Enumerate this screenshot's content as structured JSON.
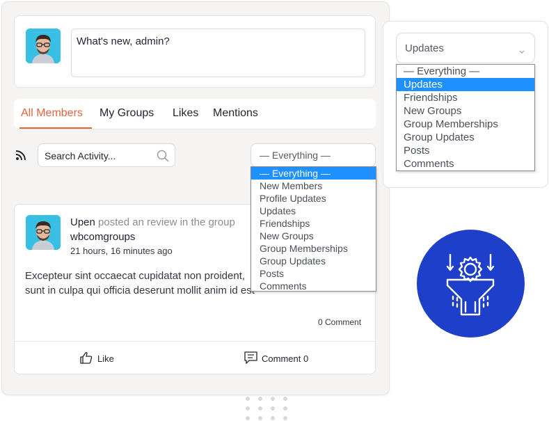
{
  "composer": {
    "placeholder": "What's new, admin?"
  },
  "tabs": [
    {
      "label": "All Members"
    },
    {
      "label": "My Groups"
    },
    {
      "label": "Likes"
    },
    {
      "label": "Mentions"
    }
  ],
  "search": {
    "placeholder": "Search Activity..."
  },
  "filter_main": {
    "selected": "— Everything —",
    "options": [
      "— Everything —",
      "New Members",
      "Profile Updates",
      "Updates",
      "Friendships",
      "New Groups",
      "Group Memberships",
      "Group Updates",
      "Posts",
      "Comments"
    ]
  },
  "filter_side": {
    "selected": "Updates",
    "options": [
      "— Everything —",
      "Updates",
      "Friendships",
      "New Groups",
      "Group Memberships",
      "Group Updates",
      "Posts",
      "Comments"
    ]
  },
  "activity": {
    "user": "Upen",
    "action": "posted an review in the group",
    "group": "wbcomgroups",
    "time": "21 hours, 16 minutes ago",
    "body": "Excepteur sint occaecat cupidatat non proident, sunt in culpa qui officia deserunt mollit anim id est laborum.",
    "comment_count": "0 Comment",
    "like_label": "Like",
    "comment_label": "Comment 0"
  },
  "colors": {
    "accent": "#e8623f",
    "selection": "#1e90ff",
    "badge": "#1e3fc9"
  },
  "icons": [
    "rss-icon",
    "search-icon",
    "chevron-down-icon",
    "thumbs-up-icon",
    "comment-icon",
    "filter-gear-icon"
  ]
}
